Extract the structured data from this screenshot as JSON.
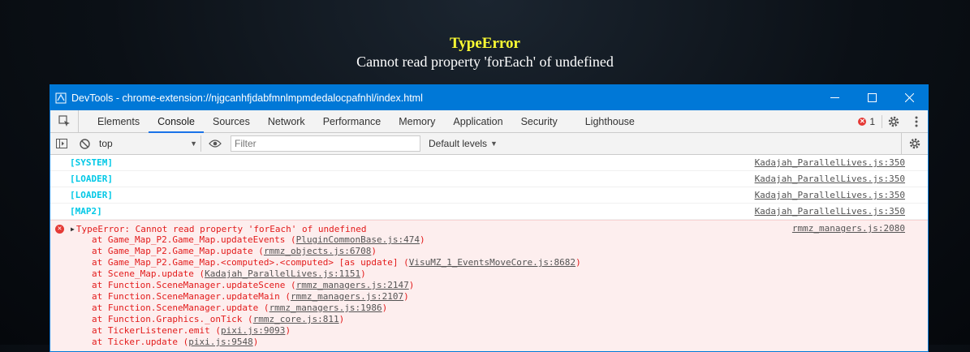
{
  "error_overlay": {
    "title": "TypeError",
    "message": "Cannot read property 'forEach' of undefined"
  },
  "window": {
    "title": "DevTools - chrome-extension://njgcanhfjdabfmnlmpmdedalocpafnhl/index.html",
    "icons": [
      "devtools-app-icon",
      "minimize-icon",
      "maximize-icon",
      "close-icon"
    ]
  },
  "tabs": [
    "Elements",
    "Console",
    "Sources",
    "Network",
    "Performance",
    "Memory",
    "Application",
    "Security",
    "Lighthouse"
  ],
  "active_tab": "Console",
  "error_count": "1",
  "toolbar": {
    "context": "top",
    "filter_placeholder": "Filter",
    "levels": "Default levels"
  },
  "logs": [
    {
      "tag": "[SYSTEM]",
      "source": "Kadajah_ParallelLives.js:350"
    },
    {
      "tag": "[LOADER]",
      "source": "Kadajah_ParallelLives.js:350"
    },
    {
      "tag": "[LOADER]",
      "source": "Kadajah_ParallelLives.js:350"
    },
    {
      "tag": "[MAP2]",
      "source": "Kadajah_ParallelLives.js:350"
    }
  ],
  "error": {
    "message": "TypeError: Cannot read property 'forEach' of undefined",
    "source": "rmmz_managers.js:2080",
    "stack": [
      {
        "text": "at Game_Map_P2.Game_Map.updateEvents",
        "link": "PluginCommonBase.js:474"
      },
      {
        "text": "at Game_Map_P2.Game_Map.update",
        "link": "rmmz_objects.js:6708"
      },
      {
        "text": "at Game_Map_P2.Game_Map.<computed>.<computed> [as update]",
        "link": "VisuMZ_1_EventsMoveCore.js:8682"
      },
      {
        "text": "at Scene_Map.update",
        "link": "Kadajah_ParallelLives.js:1151"
      },
      {
        "text": "at Function.SceneManager.updateScene",
        "link": "rmmz_managers.js:2147"
      },
      {
        "text": "at Function.SceneManager.updateMain",
        "link": "rmmz_managers.js:2107"
      },
      {
        "text": "at Function.SceneManager.update",
        "link": "rmmz_managers.js:1986"
      },
      {
        "text": "at Function.Graphics._onTick",
        "link": "rmmz_core.js:811"
      },
      {
        "text": "at TickerListener.emit",
        "link": "pixi.js:9093"
      },
      {
        "text": "at Ticker.update",
        "link": "pixi.js:9548"
      }
    ]
  }
}
